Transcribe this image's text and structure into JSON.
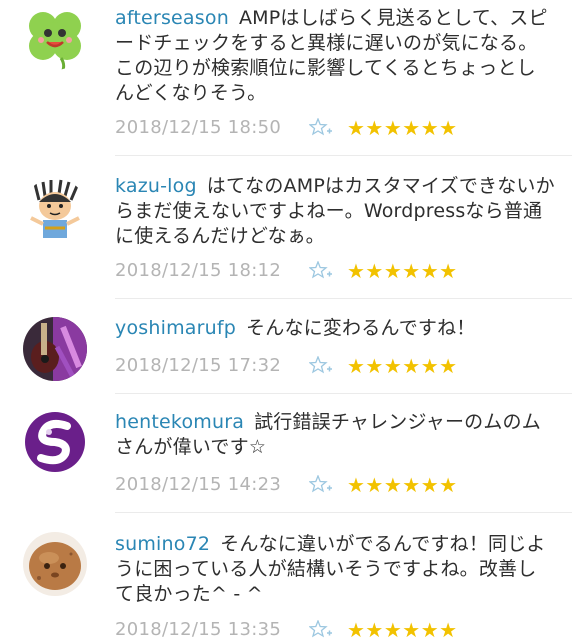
{
  "comments": [
    {
      "username": "afterseason",
      "text": "AMPはしばらく見送るとして、スピードチェックをすると異様に遅いのが気になる。この辺りが検索順位に影響してくるとちょっとしんどくなりそう。",
      "timestamp": "2018/12/15 18:50",
      "stars": "★★★★★★",
      "avatar_icon": "clover-avatar-icon"
    },
    {
      "username": "kazu-log",
      "text": "はてなのAMPはカスタマイズできないからまだ使えないですよねー。Wordpressなら普通に使えるんだけどなぁ。",
      "timestamp": "2018/12/15 18:12",
      "stars": "★★★★★★",
      "avatar_icon": "character-avatar-icon"
    },
    {
      "username": "yoshimarufp",
      "text": "そんなに変わるんですね！",
      "timestamp": "2018/12/15 17:32",
      "stars": "★★★★★★",
      "avatar_icon": "guitar-photo-avatar-icon"
    },
    {
      "username": "hentekomura",
      "text": "試行錯誤チャレンジャーのムのムさんが偉いです☆",
      "timestamp": "2018/12/15 14:23",
      "stars": "★★★★★★",
      "avatar_icon": "s-logo-avatar-icon"
    },
    {
      "username": "sumino72",
      "text": "そんなに違いがでるんですね！同じように困っている人が結構いそうですよね。改善して良かった^ - ^",
      "timestamp": "2018/12/15 13:35",
      "stars": "★★★★★★",
      "avatar_icon": "potato-avatar-icon"
    }
  ],
  "colors": {
    "username": "#2a86b4",
    "timestamp": "#b4b4b4",
    "star": "#f2c200",
    "star_add": "#9cc7e0"
  }
}
